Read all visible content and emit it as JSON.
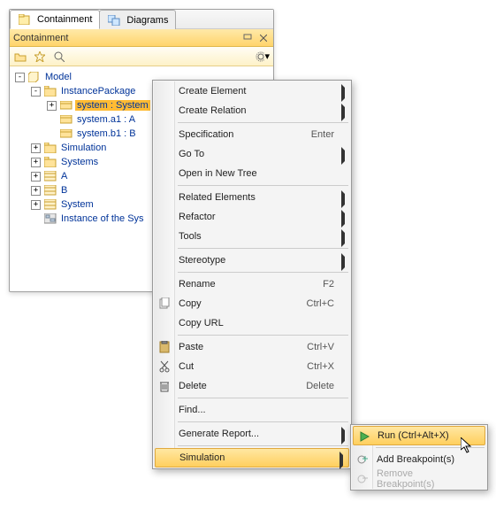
{
  "tabs": [
    {
      "label": "Containment",
      "active": true
    },
    {
      "label": "Diagrams",
      "active": false
    }
  ],
  "panel_title": "Containment",
  "tree": {
    "root": "Model",
    "items": [
      {
        "depth": 0,
        "exp": "-",
        "icon": "model",
        "label": "Model"
      },
      {
        "depth": 1,
        "exp": "-",
        "icon": "pkg",
        "label": "InstancePackage"
      },
      {
        "depth": 2,
        "exp": "+",
        "icon": "inst",
        "label": "system : System",
        "selected": true
      },
      {
        "depth": 2,
        "exp": " ",
        "icon": "inst",
        "label": "system.a1 : A"
      },
      {
        "depth": 2,
        "exp": " ",
        "icon": "inst",
        "label": "system.b1 : B"
      },
      {
        "depth": 1,
        "exp": "+",
        "icon": "pkg",
        "label": "Simulation"
      },
      {
        "depth": 1,
        "exp": "+",
        "icon": "pkg",
        "label": "Systems"
      },
      {
        "depth": 1,
        "exp": "+",
        "icon": "cls",
        "label": "A"
      },
      {
        "depth": 1,
        "exp": "+",
        "icon": "cls",
        "label": "B"
      },
      {
        "depth": 1,
        "exp": "+",
        "icon": "cls",
        "label": "System"
      },
      {
        "depth": 1,
        "exp": " ",
        "icon": "diag",
        "label": "Instance of the Sys"
      }
    ]
  },
  "menu": [
    {
      "type": "item",
      "label": "Create Element",
      "submenu": true
    },
    {
      "type": "item",
      "label": "Create Relation",
      "submenu": true
    },
    {
      "type": "sep"
    },
    {
      "type": "item",
      "label": "Specification",
      "accel": "Enter"
    },
    {
      "type": "item",
      "label": "Go To",
      "submenu": true
    },
    {
      "type": "item",
      "label": "Open in New Tree"
    },
    {
      "type": "sep"
    },
    {
      "type": "item",
      "label": "Related Elements",
      "submenu": true
    },
    {
      "type": "item",
      "label": "Refactor",
      "submenu": true
    },
    {
      "type": "item",
      "label": "Tools",
      "submenu": true
    },
    {
      "type": "sep"
    },
    {
      "type": "item",
      "label": "Stereotype",
      "submenu": true
    },
    {
      "type": "sep"
    },
    {
      "type": "item",
      "label": "Rename",
      "accel": "F2"
    },
    {
      "type": "item",
      "label": "Copy",
      "accel": "Ctrl+C",
      "icon": "copy"
    },
    {
      "type": "item",
      "label": "Copy URL"
    },
    {
      "type": "sep"
    },
    {
      "type": "item",
      "label": "Paste",
      "accel": "Ctrl+V",
      "icon": "paste"
    },
    {
      "type": "item",
      "label": "Cut",
      "accel": "Ctrl+X",
      "icon": "cut"
    },
    {
      "type": "item",
      "label": "Delete",
      "accel": "Delete",
      "icon": "delete"
    },
    {
      "type": "sep"
    },
    {
      "type": "item",
      "label": "Find..."
    },
    {
      "type": "sep"
    },
    {
      "type": "item",
      "label": "Generate Report...",
      "submenu": true
    },
    {
      "type": "sep"
    },
    {
      "type": "item",
      "label": "Simulation",
      "submenu": true,
      "hl": true
    }
  ],
  "submenu": [
    {
      "label": "Run (Ctrl+Alt+X)",
      "icon": "run",
      "hl": true
    },
    {
      "sep": true
    },
    {
      "label": "Add Breakpoint(s)",
      "icon": "bpadd"
    },
    {
      "label": "Remove Breakpoint(s)",
      "icon": "bprem",
      "disabled": true
    }
  ]
}
